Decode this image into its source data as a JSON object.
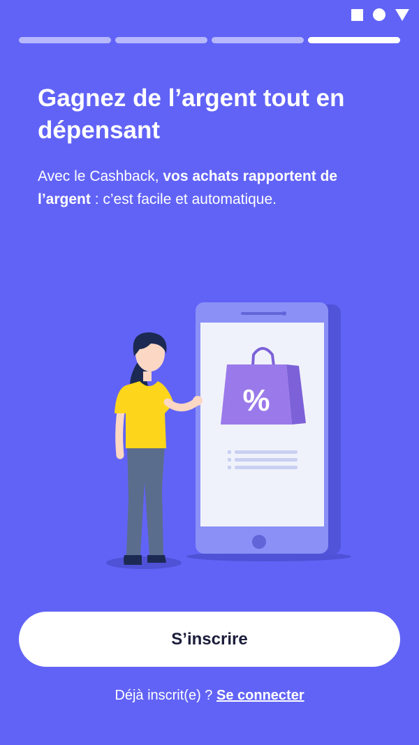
{
  "status_bar": {
    "icons": [
      "square-icon",
      "circle-icon",
      "triangle-icon"
    ]
  },
  "onboarding": {
    "progress": {
      "total_steps": 4,
      "current_step": 4
    },
    "title": "Gagnez de l’argent tout en dépensant",
    "subtitle": {
      "part1": "Avec le Cashback, ",
      "bold": "vos achats rapportent de l’argent",
      "part2": " : c’est facile et automatique."
    },
    "illustration": {
      "bag_symbol": "%"
    }
  },
  "actions": {
    "signup_label": "S’inscrire",
    "login_prompt": "Déjà inscrit(e) ? ",
    "login_link": "Se connecter"
  },
  "colors": {
    "background": "#6163f6",
    "bag": "#9a79ea",
    "shirt": "#fdd51a",
    "phone_frame": "#8a90f6",
    "button_text": "#1b1d3a"
  }
}
